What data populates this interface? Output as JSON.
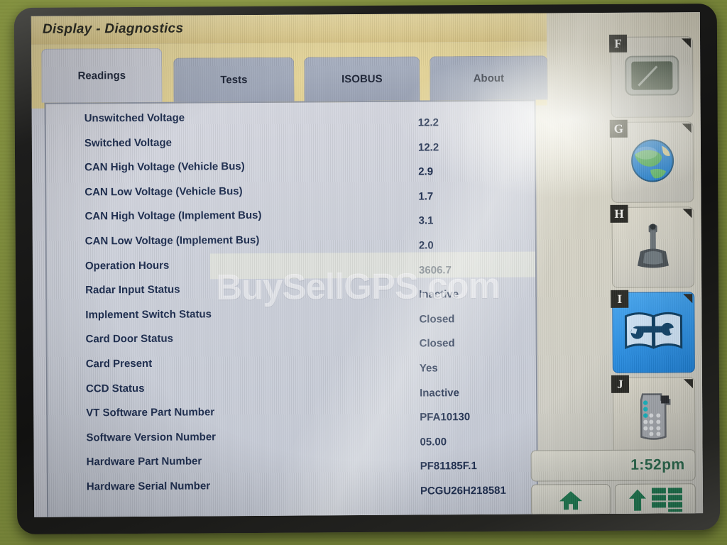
{
  "window": {
    "title": "Display - Diagnostics"
  },
  "tabs": [
    {
      "label": "Readings",
      "active": true
    },
    {
      "label": "Tests",
      "active": false
    },
    {
      "label": "ISOBUS",
      "active": false
    },
    {
      "label": "About",
      "active": false
    }
  ],
  "readings": {
    "rows": [
      {
        "label": "Unswitched Voltage",
        "value": "12.2"
      },
      {
        "label": "Switched Voltage",
        "value": "12.2"
      },
      {
        "label": "CAN High Voltage (Vehicle Bus)",
        "value": "2.9"
      },
      {
        "label": "CAN Low Voltage (Vehicle Bus)",
        "value": "1.7"
      },
      {
        "label": "CAN High Voltage (Implement Bus)",
        "value": "3.1"
      },
      {
        "label": "CAN Low Voltage (Implement Bus)",
        "value": "2.0"
      },
      {
        "label": "Operation Hours",
        "value": "3606.7"
      },
      {
        "label": "Radar Input Status",
        "value": "Inactive"
      },
      {
        "label": "Implement Switch Status",
        "value": "Closed"
      },
      {
        "label": "Card Door Status",
        "value": "Closed"
      },
      {
        "label": "Card Present",
        "value": "Yes"
      },
      {
        "label": "CCD Status",
        "value": "Inactive"
      },
      {
        "label": "VT Software Part Number",
        "value": "PFA10130"
      },
      {
        "label": "Software Version Number",
        "value": "05.00"
      },
      {
        "label": "Hardware Part Number",
        "value": "PF81185F.1"
      },
      {
        "label": "Hardware Serial Number",
        "value": "PCGU26H218581"
      }
    ]
  },
  "watermark": {
    "text": "BuySellGPS.com"
  },
  "sidebar": {
    "buttons": [
      {
        "letter": "F",
        "icon": "display-monitor-icon",
        "selected": false
      },
      {
        "letter": "G",
        "icon": "globe-icon",
        "selected": false
      },
      {
        "letter": "H",
        "icon": "joystick-icon",
        "selected": false
      },
      {
        "letter": "I",
        "icon": "diagnostics-manual-wrench-icon",
        "selected": true
      },
      {
        "letter": "J",
        "icon": "keypad-remote-icon",
        "selected": false
      }
    ]
  },
  "statusbar": {
    "clock": "1:52pm",
    "home_icon": "home-icon",
    "menu_up_icon": "arrow-up-icon",
    "menu_grid_icon": "grid-icon"
  },
  "colors": {
    "title_bar": "#e8d79a",
    "selected_button": "#2f93e6",
    "text": "#1c2c4e",
    "clock_text": "#2a6a4e",
    "bezel": "#1d1d1c",
    "backdrop": "#7c8a3b"
  }
}
